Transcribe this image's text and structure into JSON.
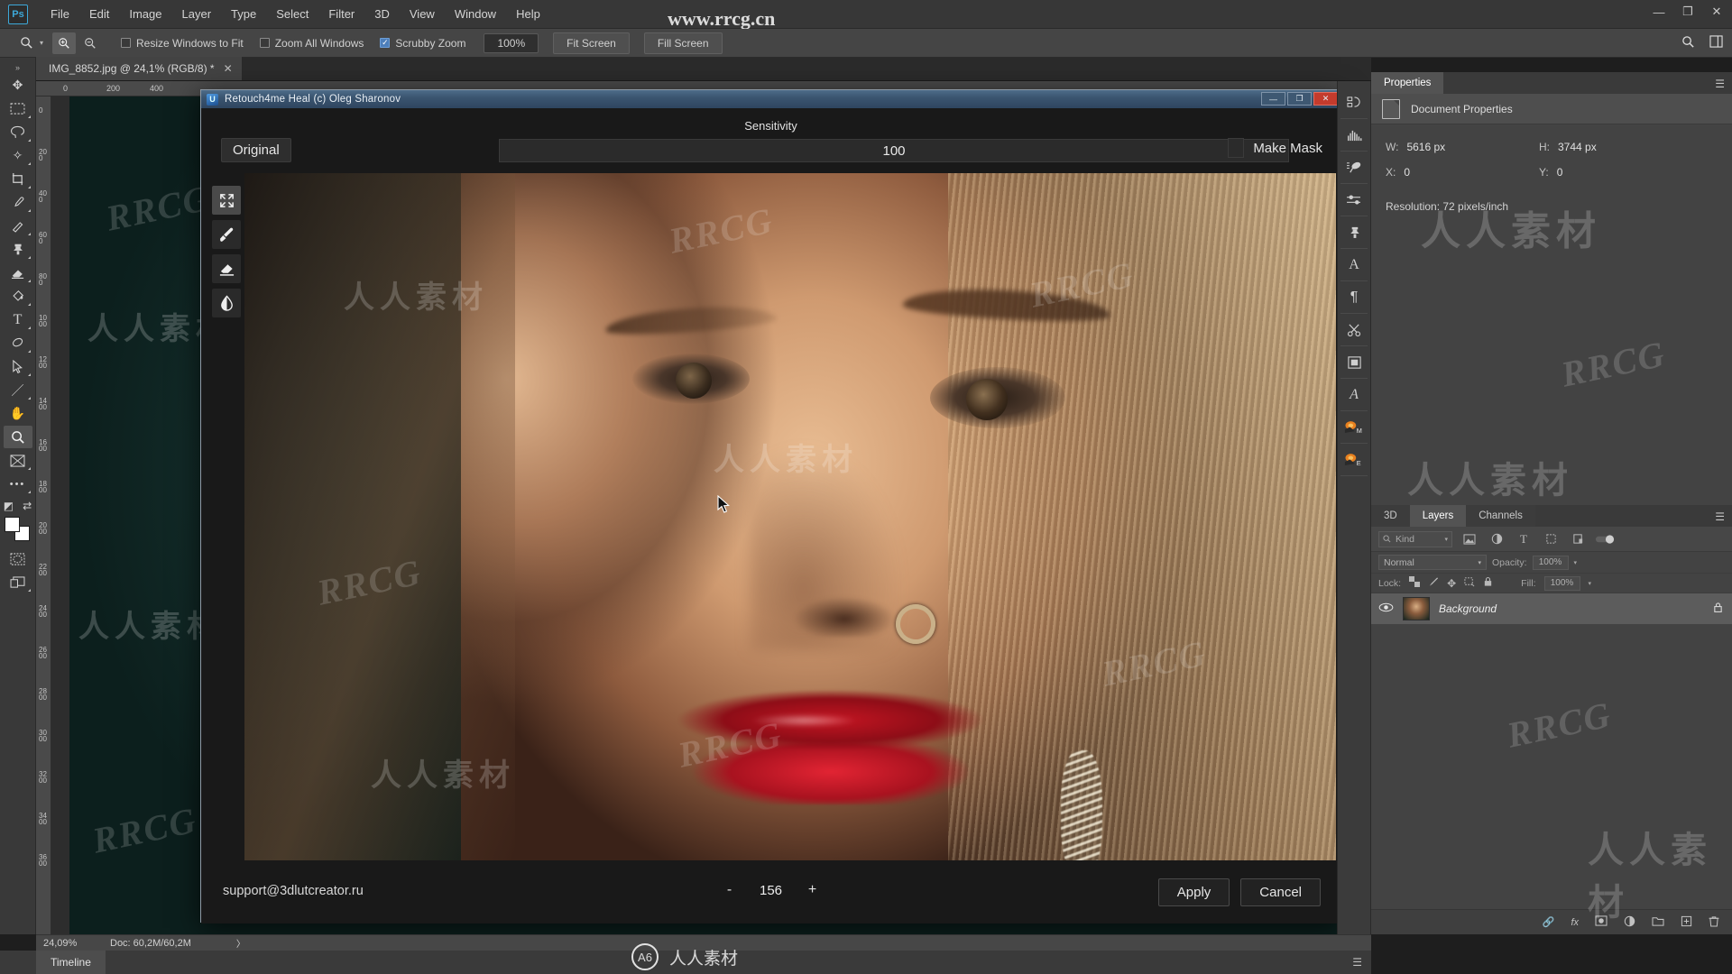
{
  "app": {
    "logo": "Ps",
    "menus": [
      "File",
      "Edit",
      "Image",
      "Layer",
      "Type",
      "Select",
      "Filter",
      "3D",
      "View",
      "Window",
      "Help"
    ],
    "window_buttons": [
      "—",
      "❐",
      "✕"
    ]
  },
  "options_bar": {
    "tool_icon": "zoom-tool-icon",
    "zoom_in_icon": "⊕",
    "zoom_out_icon": "⊖",
    "checkboxes": [
      {
        "label": "Resize Windows to Fit",
        "checked": false
      },
      {
        "label": "Zoom All Windows",
        "checked": false
      },
      {
        "label": "Scrubby Zoom",
        "checked": true
      }
    ],
    "zoom_field": "100%",
    "buttons": [
      "Fit Screen",
      "Fill Screen"
    ],
    "search_icon": "search-icon",
    "workspace_icon": "workspace-icon"
  },
  "document_tab": {
    "label": "IMG_8852.jpg @ 24,1% (RGB/8) *",
    "close": "✕"
  },
  "left_toolbar": {
    "tools": [
      {
        "name": "move-tool",
        "glyph": "✥"
      },
      {
        "name": "rectangular-marquee-tool",
        "glyph": "▭"
      },
      {
        "name": "lasso-tool",
        "glyph": "◯"
      },
      {
        "name": "quick-selection-tool",
        "glyph": "✦"
      },
      {
        "name": "crop-tool",
        "glyph": "✄"
      },
      {
        "name": "eyedropper-tool",
        "glyph": "✎"
      },
      {
        "name": "spot-healing-brush-tool",
        "glyph": "✐"
      },
      {
        "name": "clone-stamp-tool",
        "glyph": "♟"
      },
      {
        "name": "eraser-tool",
        "glyph": "◣"
      },
      {
        "name": "gradient-tool",
        "glyph": "◩"
      },
      {
        "name": "type-tool",
        "glyph": "T"
      },
      {
        "name": "pen-tool",
        "glyph": "✒"
      },
      {
        "name": "path-selection-tool",
        "glyph": "➤"
      },
      {
        "name": "line-tool",
        "glyph": "／"
      },
      {
        "name": "hand-tool",
        "glyph": "✋"
      },
      {
        "name": "zoom-tool",
        "glyph": "🔍",
        "selected": true
      },
      {
        "name": "artboard-tool",
        "glyph": "⊠"
      },
      {
        "name": "more-tools",
        "glyph": "•••"
      }
    ],
    "quickmask_glyph": "◧",
    "screenmode_glyph": "⇱",
    "foreground_color": "#ffffff",
    "background_color": "#ffffff",
    "edit_quickmask_glyph": "◌",
    "screen_mode_glyph": "❐"
  },
  "rulers": {
    "top_ticks": [
      "0",
      "200",
      "400"
    ],
    "left_ticks": [
      "0",
      "200",
      "400",
      "600",
      "800",
      "1000",
      "1200",
      "1400",
      "1600",
      "1800",
      "2000",
      "2200",
      "2400",
      "2600",
      "2800",
      "3000",
      "3200",
      "3400",
      "3600"
    ]
  },
  "plugin_dialog": {
    "title": "Retouch4me Heal (c) Oleg Sharonov",
    "title_icon": "plugin-shield-icon",
    "window_buttons": [
      "—",
      "❐",
      "✕"
    ],
    "original_button": "Original",
    "sensitivity_label": "Sensitivity",
    "sensitivity_value": "100",
    "make_mask_label": "Make Mask",
    "make_mask_checked": false,
    "tools": [
      {
        "name": "fit-to-screen-tool",
        "glyph": "⤢",
        "selected": true
      },
      {
        "name": "brush-tool",
        "glyph": "🖌"
      },
      {
        "name": "eraser-tool",
        "glyph": "◨"
      },
      {
        "name": "contrast-tool",
        "glyph": "◑"
      }
    ],
    "support_email": "support@3dlutcreator.ru",
    "spinner": {
      "minus": "-",
      "value": "156",
      "plus": "+"
    },
    "apply_button": "Apply",
    "cancel_button": "Cancel"
  },
  "properties_panel": {
    "tab": "Properties",
    "menu_icon": "panel-menu-icon",
    "header": "Document Properties",
    "header_icon": "document-icon",
    "fields": [
      {
        "key": "W:",
        "value": "5616 px"
      },
      {
        "key": "H:",
        "value": "3744 px"
      },
      {
        "key": "X:",
        "value": "0"
      },
      {
        "key": "Y:",
        "value": "0"
      }
    ],
    "resolution": "Resolution: 72 pixels/inch"
  },
  "layers_panel": {
    "tabs": [
      "3D",
      "Layers",
      "Channels"
    ],
    "active_tab": "Layers",
    "menu_icon": "panel-menu-icon",
    "filter_placeholder": "Kind",
    "filter_icons": [
      "pixel-filter-icon",
      "adjustment-filter-icon",
      "type-filter-icon",
      "shape-filter-icon",
      "smartobject-filter-icon",
      "filter-toggle-icon"
    ],
    "blend_mode": "Normal",
    "opacity_label": "Opacity:",
    "opacity_value": "100%",
    "lock_label": "Lock:",
    "lock_icons": [
      "lock-transparent-icon",
      "lock-image-icon",
      "lock-position-icon",
      "lock-artboard-icon",
      "lock-all-icon"
    ],
    "fill_label": "Fill:",
    "fill_value": "100%",
    "layers": [
      {
        "name": "Background",
        "visible": true,
        "locked": true,
        "thumb": "layer-thumbnail"
      }
    ],
    "bottom_icons": [
      "link-layers-icon",
      "layer-style-icon",
      "layer-mask-icon",
      "adjustment-layer-icon",
      "new-group-icon",
      "new-layer-icon",
      "delete-layer-icon"
    ]
  },
  "right_icon_dock": [
    {
      "name": "history-icon",
      "glyph": "↻"
    },
    {
      "name": "histogram-icon",
      "glyph": "▥"
    },
    {
      "name": "brush-settings-icon",
      "glyph": "🖌"
    },
    {
      "name": "brush-presets-icon",
      "glyph": "⚌"
    },
    {
      "name": "clone-source-icon",
      "glyph": "♟"
    },
    {
      "name": "character-icon",
      "glyph": "A"
    },
    {
      "name": "paragraph-icon",
      "glyph": "¶"
    },
    {
      "name": "scissors-icon",
      "glyph": "✂"
    },
    {
      "name": "library-icon",
      "glyph": "▣"
    },
    {
      "name": "glyphs-icon",
      "glyph": "A"
    },
    {
      "name": "measure-m-icon",
      "glyph": "M"
    },
    {
      "name": "measure-e-icon",
      "glyph": "E"
    }
  ],
  "status_bar": {
    "zoom": "24,09%",
    "doc": "Doc: 60,2M/60,2M",
    "arrow": "〉"
  },
  "timeline": {
    "tab": "Timeline",
    "menu_icon": "panel-menu-icon"
  },
  "watermarks": {
    "top_url": "www.rrcg.cn",
    "bottom_text": "人人素材",
    "bottom_logo": "A6",
    "rrcg": "RRCG",
    "chinese": "人人素材"
  },
  "colors": {
    "accent": "#3da8d8",
    "panel_bg": "#434343",
    "toolbar_bg": "#393939",
    "menu_bg": "#373737",
    "dialog_title": "#3b5570",
    "close_red": "#c43b2d"
  }
}
